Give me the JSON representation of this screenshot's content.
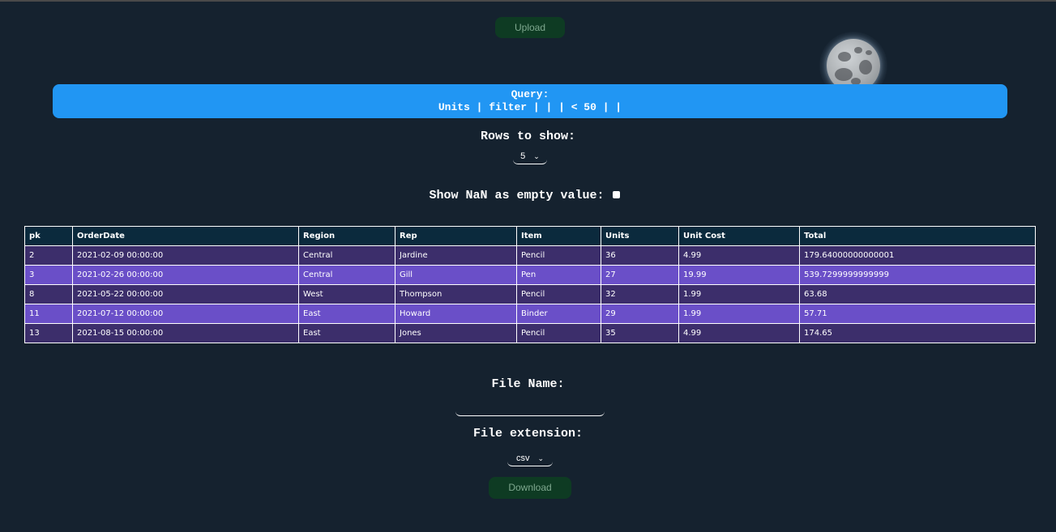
{
  "buttons": {
    "upload": "Upload",
    "download": "Download"
  },
  "theme_toggle": {
    "icon": "moon-icon"
  },
  "query": {
    "label": "Query:",
    "expression": "Units | filter | | | < 50 | |"
  },
  "rows": {
    "label": "Rows to show:",
    "selected": "5"
  },
  "nan_option": {
    "label": "Show NaN as empty value:",
    "checked": false
  },
  "table": {
    "columns": [
      "pk",
      "OrderDate",
      "Region",
      "Rep",
      "Item",
      "Units",
      "Unit Cost",
      "Total"
    ],
    "rows": [
      [
        "2",
        "2021-02-09 00:00:00",
        "Central",
        "Jardine",
        "Pencil",
        "36",
        "4.99",
        "179.64000000000001"
      ],
      [
        "3",
        "2021-02-26 00:00:00",
        "Central",
        "Gill",
        "Pen",
        "27",
        "19.99",
        "539.7299999999999"
      ],
      [
        "8",
        "2021-05-22 00:00:00",
        "West",
        "Thompson",
        "Pencil",
        "32",
        "1.99",
        "63.68"
      ],
      [
        "11",
        "2021-07-12 00:00:00",
        "East",
        "Howard",
        "Binder",
        "29",
        "1.99",
        "57.71"
      ],
      [
        "13",
        "2021-08-15 00:00:00",
        "East",
        "Jones",
        "Pencil",
        "35",
        "4.99",
        "174.65"
      ]
    ]
  },
  "file": {
    "name_label": "File Name:",
    "name_value": "",
    "ext_label": "File extension:",
    "ext_selected": "csv"
  },
  "colors": {
    "background": "#15222f",
    "query_bar": "#2196f3",
    "button_bg": "#0e3b23",
    "row_odd": "#3c2e6b",
    "row_even": "#6a4fc8",
    "header_bg": "#0b2a3d"
  }
}
